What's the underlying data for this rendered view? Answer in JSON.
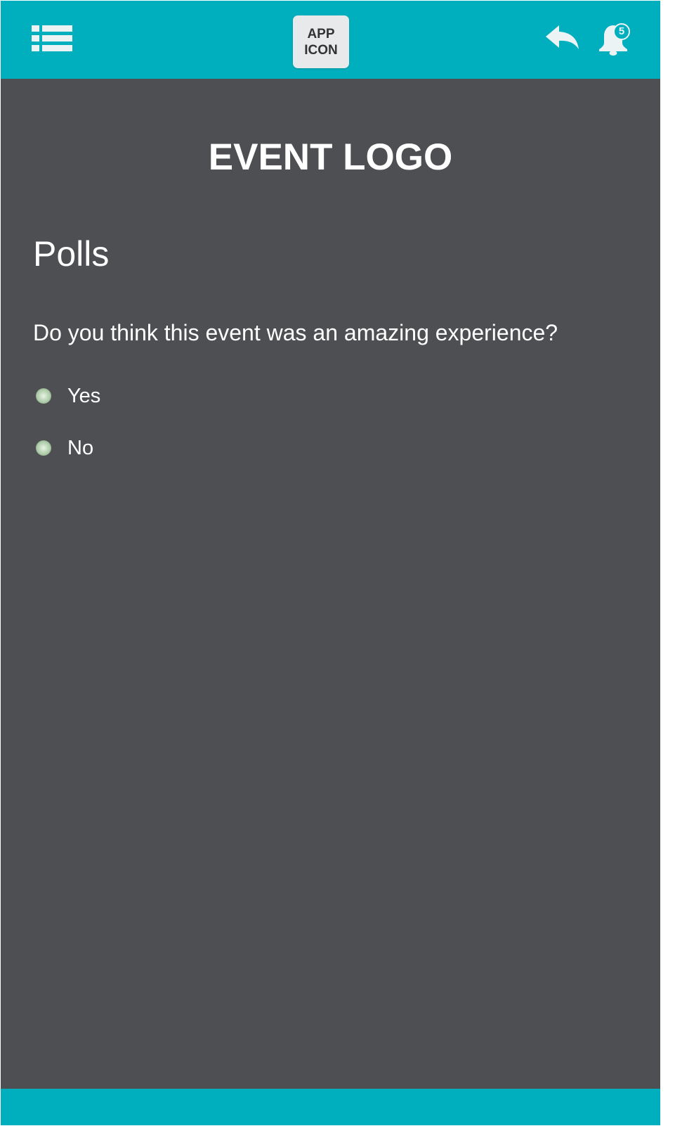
{
  "header": {
    "menu_icon": "list-menu-icon",
    "app_icon_text": [
      "APP",
      "ICON"
    ],
    "back_icon": "reply-arrow-icon",
    "notification_icon": "bell-icon",
    "notification_count": "5"
  },
  "main": {
    "event_logo": "EVENT LOGO",
    "title": "Polls",
    "question": "Do you think this event was an amazing experience?",
    "options": [
      {
        "label": "Yes",
        "selected": false
      },
      {
        "label": "No",
        "selected": false
      }
    ]
  },
  "colors": {
    "accent": "#00afbd",
    "background": "#4e4f52",
    "icon": "#ebf3f5",
    "text": "#ffffff",
    "radio": "#b9d4b4"
  }
}
